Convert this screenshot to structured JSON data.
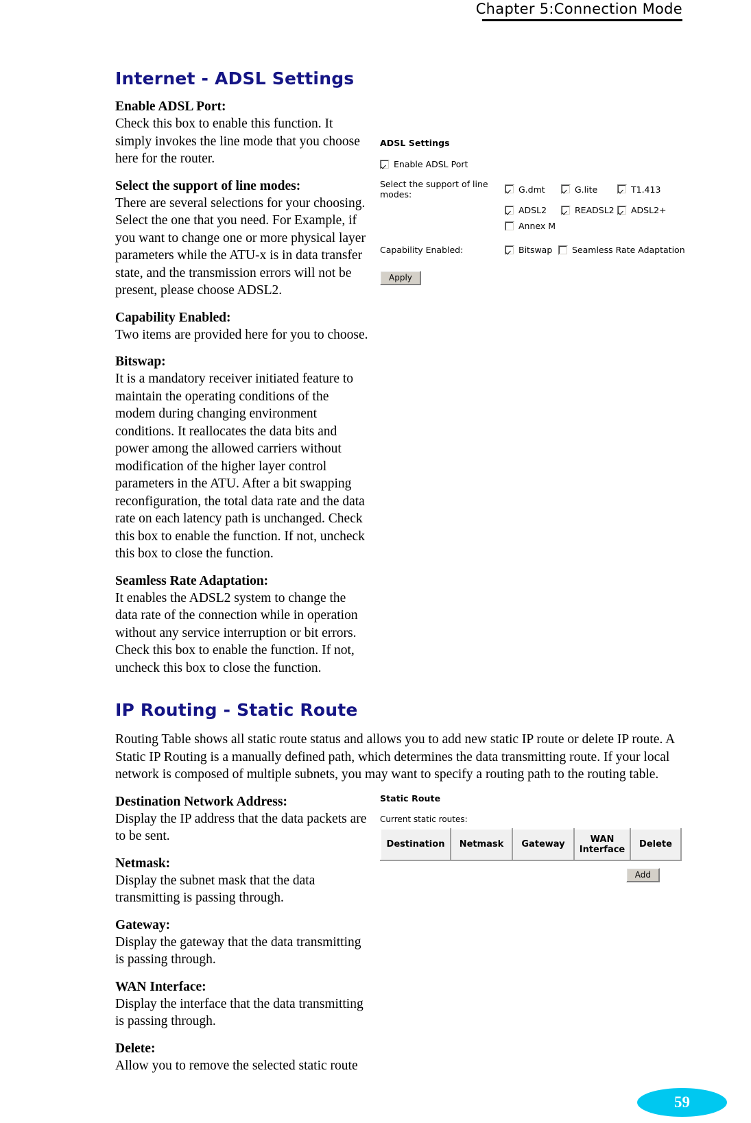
{
  "header": {
    "chapter_title": "Chapter 5:Connection Mode"
  },
  "sections": {
    "adsl": {
      "heading": "Internet - ADSL Settings",
      "definitions": [
        {
          "term": "Enable ADSL Port:",
          "desc": "Check this box to enable this function. It simply invokes the line mode that you choose here for the router."
        },
        {
          "term": "Select the support of line modes:",
          "desc": "There are several selections for your choosing. Select the one that you need. For Example, if you want to change one or more physical layer parameters while the ATU-x is in data transfer state, and the transmission errors will not be present, please choose ADSL2."
        },
        {
          "term": "Capability Enabled:",
          "desc": "Two items are provided here for you to choose."
        },
        {
          "term": "Bitswap:",
          "desc": "It is a mandatory receiver initiated feature to maintain the operating conditions of the modem during changing environment conditions. It reallocates the data bits and power among the allowed carriers without modification of the higher layer control parameters in the ATU. After a bit swapping reconfiguration, the total data rate and the data rate on each latency path is unchanged. Check this box to enable the function. If not, uncheck this box to close the function."
        },
        {
          "term": "Seamless Rate Adaptation:",
          "desc": "It enables the ADSL2 system to change the data rate of the connection while in operation without any service interruption or bit errors. Check this box to enable the function. If not, uncheck this box to close the function."
        }
      ]
    },
    "routing": {
      "heading": "IP Routing - Static Route",
      "intro": "Routing Table shows all static route status and allows you to add new static IP route or delete IP route. A Static IP Routing is a manually defined path, which determines the data transmitting route. If your local network is composed of multiple subnets, you may want to specify a routing path to the routing table.",
      "definitions": [
        {
          "term": "Destination Network Address:",
          "desc": "Display the IP address that the data packets are to be sent."
        },
        {
          "term": "Netmask:",
          "desc": "Display the subnet mask that the data transmitting is passing through."
        },
        {
          "term": "Gateway:",
          "desc": "Display the gateway that the data transmitting is passing through."
        },
        {
          "term": "WAN Interface:",
          "desc": "Display the interface that the data transmitting is passing through."
        },
        {
          "term": "Delete:",
          "desc": "Allow you to remove the selected static route"
        }
      ]
    }
  },
  "adsl_screenshot": {
    "title": "ADSL Settings",
    "enable_port": {
      "label": "Enable ADSL Port",
      "checked": true
    },
    "line_modes_label": "Select the support of line modes:",
    "line_modes": [
      {
        "label": "G.dmt",
        "checked": true
      },
      {
        "label": "G.lite",
        "checked": true
      },
      {
        "label": "T1.413",
        "checked": true
      },
      {
        "label": "ADSL2",
        "checked": true
      },
      {
        "label": "READSL2",
        "checked": true
      },
      {
        "label": "ADSL2+",
        "checked": true
      },
      {
        "label": "Annex M",
        "checked": false
      }
    ],
    "capability_label": "Capability Enabled:",
    "capability_options": [
      {
        "label": "Bitswap",
        "checked": true
      },
      {
        "label": "Seamless Rate Adaptation",
        "checked": false
      }
    ],
    "apply_button": "Apply"
  },
  "static_route_screenshot": {
    "title": "Static Route",
    "subtitle": "Current static routes:",
    "columns": [
      "Destination",
      "Netmask",
      "Gateway",
      "WAN Interface",
      "Delete"
    ],
    "rows": [],
    "add_button": "Add"
  },
  "footer": {
    "page_number": "59"
  }
}
